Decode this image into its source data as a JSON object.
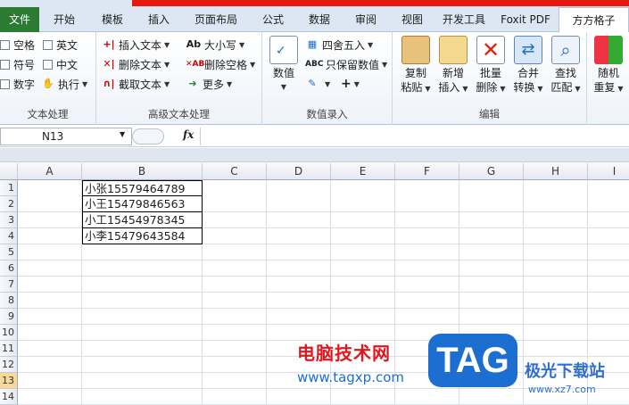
{
  "tabs": [
    "文件",
    "开始",
    "模板",
    "插入",
    "页面布局",
    "公式",
    "数据",
    "审阅",
    "视图",
    "开发工具",
    "Foxit PDF",
    "方方格子"
  ],
  "ribbon": {
    "group1": {
      "label": "文本处理",
      "checks": [
        "空格",
        "英文",
        "符号",
        "中文",
        "数字"
      ],
      "execute": "执行"
    },
    "group2": {
      "label": "高级文本处理",
      "items": [
        "插入文本",
        "删除文本",
        "截取文本",
        "大小写",
        "删除空格",
        "更多"
      ]
    },
    "group3": {
      "label": "数值录入",
      "big": "数值",
      "items": [
        "四舍五入",
        "只保留数值"
      ],
      "plus": "+"
    },
    "group4": {
      "label": "编辑",
      "buttons": [
        {
          "l1": "复制",
          "l2": "粘贴"
        },
        {
          "l1": "新增",
          "l2": "插入"
        },
        {
          "l1": "批量",
          "l2": "删除"
        },
        {
          "l1": "合并",
          "l2": "转换"
        },
        {
          "l1": "查找",
          "l2": "匹配"
        }
      ]
    },
    "group5": {
      "l1": "随机",
      "l2": "重复"
    }
  },
  "formula": {
    "namebox": "N13",
    "fx": "fx",
    "value": ""
  },
  "columns": [
    "A",
    "B",
    "C",
    "D",
    "E",
    "F",
    "G",
    "H",
    "I"
  ],
  "rows": [
    "1",
    "2",
    "3",
    "4",
    "5",
    "6",
    "7",
    "8",
    "9",
    "10",
    "11",
    "12",
    "13",
    "14"
  ],
  "cells": [
    "小张15579464789",
    "小王15479846563",
    "小工15454978345",
    "小李15479643584"
  ],
  "watermark": {
    "cn": "电脑技术网",
    "url": "www.tagxp.com",
    "tag": "TAG",
    "site_cn": "极光下载站",
    "site_url": "www.xz7.com"
  },
  "colors": {
    "file_tab": "#2c7b33",
    "accent_red": "#e8170f",
    "selected_row": "#f9d99a"
  }
}
